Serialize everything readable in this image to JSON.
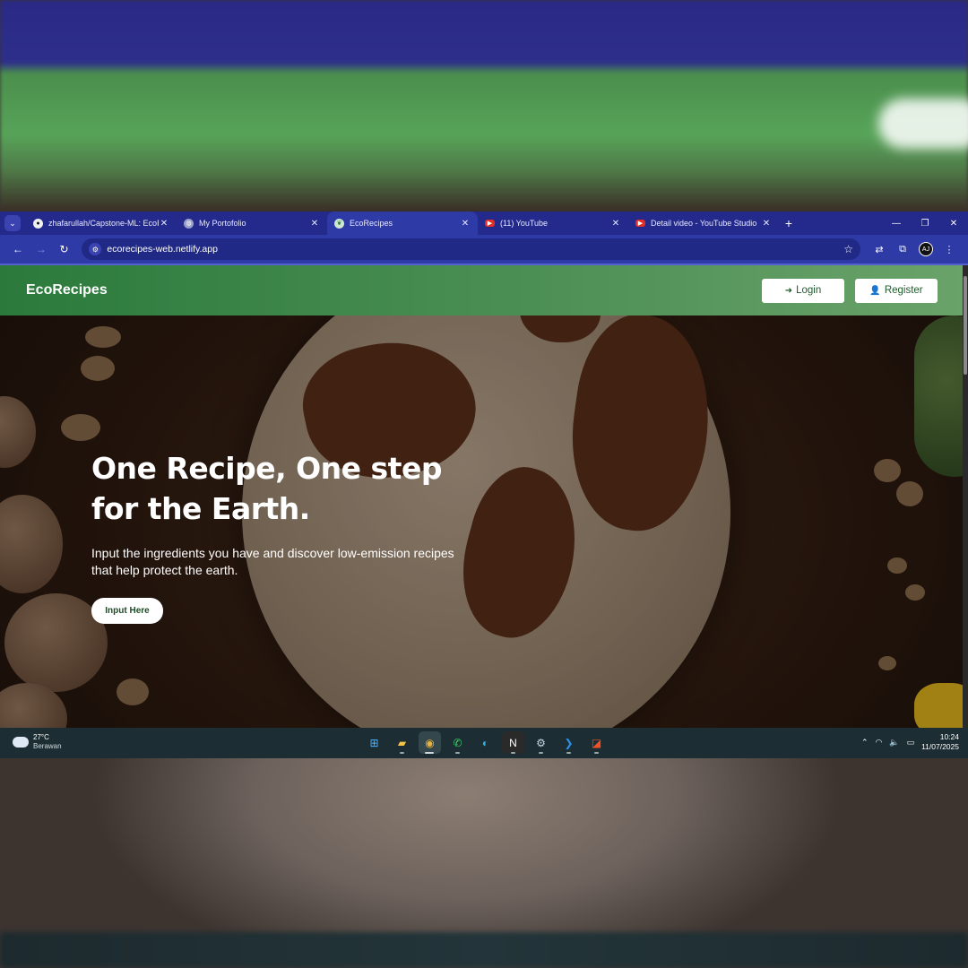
{
  "browser": {
    "tabs": [
      {
        "title": "zhafarullah/Capstone-ML: EcoR",
        "icon": "github-icon",
        "active": false
      },
      {
        "title": "My Portofolio",
        "icon": "globe-icon",
        "active": false
      },
      {
        "title": "EcoRecipes",
        "icon": "leaf-icon",
        "active": true
      },
      {
        "title": "(11) YouTube",
        "icon": "youtube-icon",
        "active": false
      },
      {
        "title": "Detail video - YouTube Studio",
        "icon": "youtube-studio-icon",
        "active": false
      }
    ],
    "url": "ecorecipes-web.netlify.app",
    "profile_initials": "AJ"
  },
  "site": {
    "brand": "EcoRecipes",
    "login_label": "Login",
    "register_label": "Register",
    "hero": {
      "title": "One Recipe, One step for the Earth.",
      "subtitle": "Input the ingredients you have and discover low-emission recipes that help protect the earth.",
      "cta_label": "Input Here"
    }
  },
  "taskbar": {
    "weather_temp": "27°C",
    "weather_condition": "Berawan",
    "time": "10:24",
    "date": "11/07/2025",
    "apps": [
      "windows-start-icon",
      "file-explorer-icon",
      "chrome-icon",
      "whatsapp-icon",
      "edge-icon",
      "notion-icon",
      "steam-icon",
      "vscode-icon",
      "office-icon"
    ]
  },
  "colors": {
    "tabstrip": "#232a8c",
    "toolbar": "#2e3aa6",
    "header_green": "#4c8f55",
    "taskbar": "#1c2e33"
  }
}
